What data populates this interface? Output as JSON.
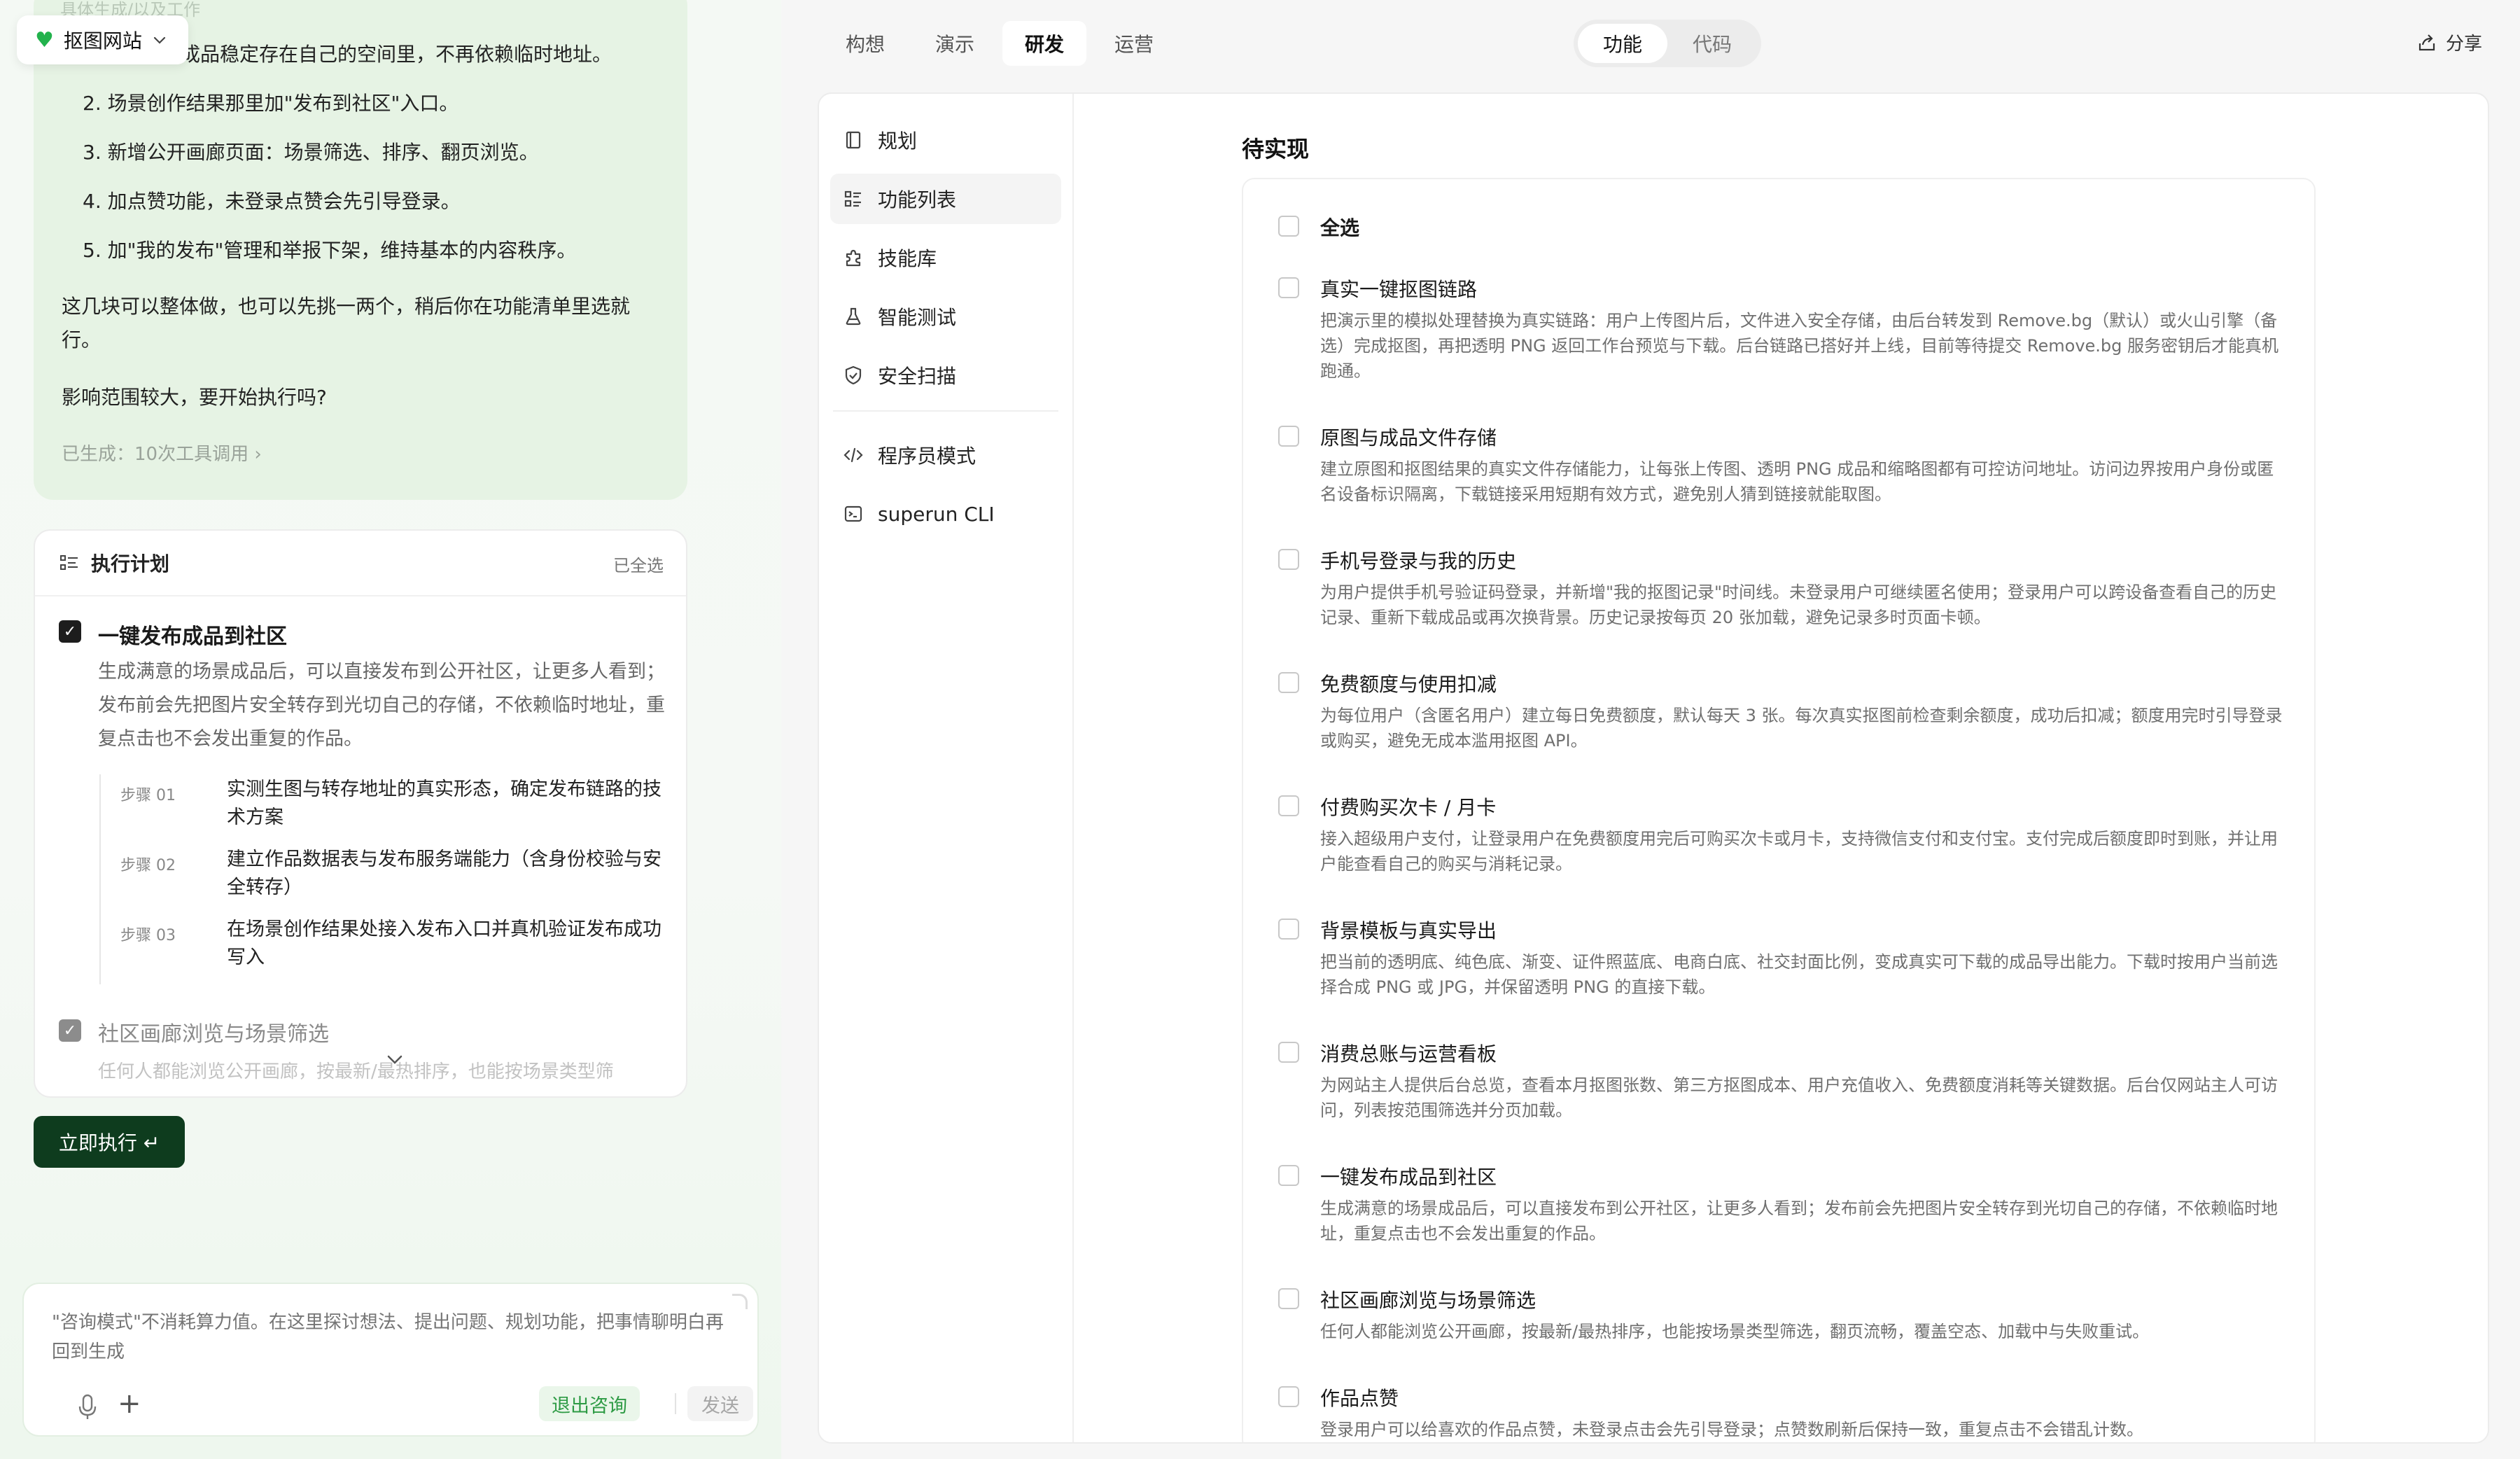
{
  "app": {
    "name": "抠图网站"
  },
  "chat": {
    "faded_top": "具体生成/以及工作",
    "line1_tail": "成品稳定存在自己的空间里，不再依赖临时地址。",
    "list": [
      "2. 场景创作结果那里加\"发布到社区\"入口。",
      "3. 新增公开画廊页面：场景筛选、排序、翻页浏览。",
      "4. 加点赞功能，未登录点赞会先引导登录。",
      "5. 加\"我的发布\"管理和举报下架，维持基本的内容秩序。"
    ],
    "para1": "这几块可以整体做，也可以先挑一两个，稍后你在功能清单里选就行。",
    "para2": "影响范围较大，要开始执行吗?",
    "tool_calls": "已生成：10次工具调用 ›"
  },
  "plan": {
    "title": "执行计划",
    "select_all": "已全选",
    "item1": {
      "title": "一键发布成品到社区",
      "desc": "生成满意的场景成品后，可以直接发布到公开社区，让更多人看到；发布前会先把图片安全转存到光切自己的存储，不依赖临时地址，重复点击也不会发出重复的作品。",
      "steps": [
        {
          "label": "步骤 01",
          "text": "实测生图与转存地址的真实形态，确定发布链路的技术方案"
        },
        {
          "label": "步骤 02",
          "text": "建立作品数据表与发布服务端能力（含身份校验与安全转存）"
        },
        {
          "label": "步骤 03",
          "text": "在场景创作结果处接入发布入口并真机验证发布成功写入"
        }
      ]
    },
    "item2": {
      "title": "社区画廊浏览与场景筛选",
      "desc": "任何人都能浏览公开画廊，按最新/最热排序，也能按场景类型筛"
    },
    "execute_label": "立即执行 ↵"
  },
  "composer": {
    "placeholder": "\"咨询模式\"不消耗算力值。在这里探讨想法、提出问题、规划功能，把事情聊明白再回到生成",
    "exit_label": "退出咨询",
    "send_label": "发送"
  },
  "top_tabs": [
    "构想",
    "演示",
    "研发",
    "运营"
  ],
  "active_tab": "研发",
  "segment": {
    "items": [
      "功能",
      "代码"
    ],
    "active": "功能"
  },
  "share_label": "分享",
  "side_nav": {
    "items": [
      {
        "label": "规划",
        "icon": "book-icon"
      },
      {
        "label": "功能列表",
        "icon": "list-icon"
      },
      {
        "label": "技能库",
        "icon": "puzzle-icon"
      },
      {
        "label": "智能测试",
        "icon": "flask-icon"
      },
      {
        "label": "安全扫描",
        "icon": "shield-icon"
      }
    ],
    "items2": [
      {
        "label": "程序员模式",
        "icon": "code-icon"
      },
      {
        "label": "superun CLI",
        "icon": "terminal-icon"
      }
    ],
    "active": "功能列表"
  },
  "features": {
    "section_title": "待实现",
    "select_all_label": "全选",
    "items": [
      {
        "title": "真实一键抠图链路",
        "desc": "把演示里的模拟处理替换为真实链路：用户上传图片后，文件进入安全存储，由后台转发到 Remove.bg（默认）或火山引擎（备选）完成抠图，再把透明 PNG 返回工作台预览与下载。后台链路已搭好并上线，目前等待提交 Remove.bg 服务密钥后才能真机跑通。"
      },
      {
        "title": "原图与成品文件存储",
        "desc": "建立原图和抠图结果的真实文件存储能力，让每张上传图、透明 PNG 成品和缩略图都有可控访问地址。访问边界按用户身份或匿名设备标识隔离，下载链接采用短期有效方式，避免别人猜到链接就能取图。"
      },
      {
        "title": "手机号登录与我的历史",
        "desc": "为用户提供手机号验证码登录，并新增\"我的抠图记录\"时间线。未登录用户可继续匿名使用；登录用户可以跨设备查看自己的历史记录、重新下载成品或再次换背景。历史记录按每页 20 张加载，避免记录多时页面卡顿。"
      },
      {
        "title": "免费额度与使用扣减",
        "desc": "为每位用户（含匿名用户）建立每日免费额度，默认每天 3 张。每次真实抠图前检查剩余额度，成功后扣减；额度用完时引导登录或购买，避免无成本滥用抠图 API。"
      },
      {
        "title": "付费购买次卡 / 月卡",
        "desc": "接入超级用户支付，让登录用户在免费额度用完后可购买次卡或月卡，支持微信支付和支付宝。支付完成后额度即时到账，并让用户能查看自己的购买与消耗记录。"
      },
      {
        "title": "背景模板与真实导出",
        "desc": "把当前的透明底、纯色底、渐变、证件照蓝底、电商白底、社交封面比例，变成真实可下载的成品导出能力。下载时按用户当前选择合成 PNG 或 JPG，并保留透明 PNG 的直接下载。"
      },
      {
        "title": "消费总账与运营看板",
        "desc": "为网站主人提供后台总览，查看本月抠图张数、第三方抠图成本、用户充值收入、免费额度消耗等关键数据。后台仅网站主人可访问，列表按范围筛选并分页加载。"
      },
      {
        "title": "一键发布成品到社区",
        "desc": "生成满意的场景成品后，可以直接发布到公开社区，让更多人看到；发布前会先把图片安全转存到光切自己的存储，不依赖临时地址，重复点击也不会发出重复的作品。"
      },
      {
        "title": "社区画廊浏览与场景筛选",
        "desc": "任何人都能浏览公开画廊，按最新/最热排序，也能按场景类型筛选，翻页流畅，覆盖空态、加载中与失败重试。"
      },
      {
        "title": "作品点赞",
        "desc": "登录用户可以给喜欢的作品点赞，未登录点击会先引导登录；点赞数刷新后保持一致，重复点击不会错乱计数。"
      }
    ]
  },
  "colors": {
    "brand_green": "#22b24c",
    "execute_bg": "#0e3c1e",
    "exit_green": "#2e9b45"
  }
}
